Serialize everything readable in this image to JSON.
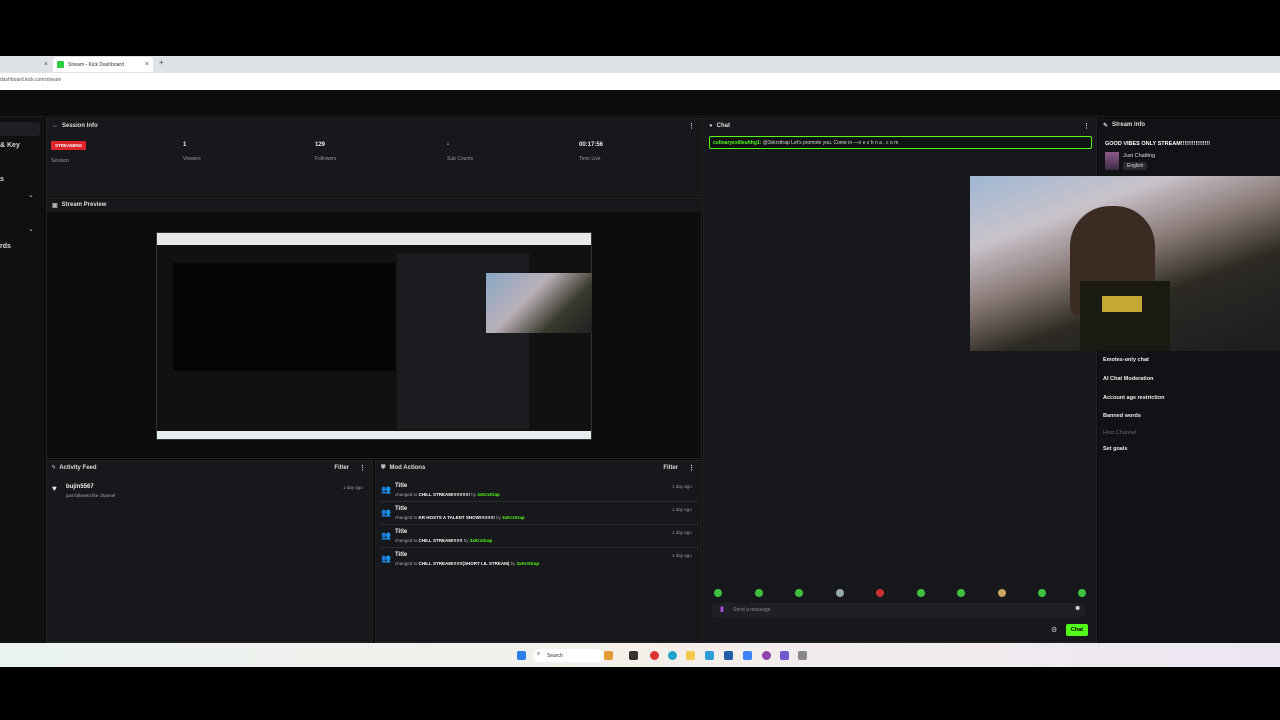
{
  "browser": {
    "tab1_close": "×",
    "tab2_title": "Stream - Kick Dashboard",
    "tab2_close": "×",
    "new_tab": "+",
    "url": "dashboard.kick.com/stream"
  },
  "sidebar": {
    "items": [
      "& Key",
      "s",
      "rds"
    ]
  },
  "session_info": {
    "title": "Session Info",
    "stats": [
      {
        "value": "STREAMING",
        "label": "Session"
      },
      {
        "value": "1",
        "label": "Viewers"
      },
      {
        "value": "129",
        "label": "Followers"
      },
      {
        "value": "-",
        "label": "Sub Counts"
      },
      {
        "value": "00:17:56",
        "label": "Time Live"
      }
    ]
  },
  "stream_preview": {
    "title": "Stream Preview"
  },
  "activity_feed": {
    "title": "Activity Feed",
    "filter": "Filter",
    "items": [
      {
        "user": "bujin5567",
        "text": "just followed the channel",
        "time": "1 day ago"
      }
    ]
  },
  "mod_actions": {
    "title": "Mod Actions",
    "filter": "Filter",
    "items": [
      {
        "title": "Title",
        "prefix": "changed to",
        "value": "CHILL STREAM!!!!!!!!!!!!",
        "by": "by",
        "user": "3xKrxttrap",
        "time": "1 day ago"
      },
      {
        "title": "Title",
        "prefix": "changed to",
        "value": "KR HOSTS A TALENT SHOW!!!!!!!!!!",
        "by": "by",
        "user": "3xKrxttrap",
        "time": "1 day ago"
      },
      {
        "title": "Title",
        "prefix": "changed to",
        "value": "CHILL STREAM!!!!!!!",
        "by": "by",
        "user": "3xKrxttrap",
        "time": "1 day ago"
      },
      {
        "title": "Title",
        "prefix": "changed to",
        "value": "CHILL STREAM!!!!!!!(SHORT LIL STREAM)",
        "by": "by",
        "user": "3xKrxttrap",
        "time": "1 day ago"
      }
    ]
  },
  "chat": {
    "title": "Chat",
    "pinned": {
      "user": "culinaryexilleuhhg1:",
      "text": "@3xkrxttrap Let's promote you. Come in —n e z h n a . c o m"
    },
    "input_placeholder": "Send a message",
    "send_label": "Chat"
  },
  "stream_info": {
    "title": "Stream info",
    "stream_title": "GOOD VIBES ONLY STREAM!!!!!!!!!!!!!!!!",
    "category": "Just Chatting",
    "language": "English"
  },
  "settings": [
    "Emotes-only chat",
    "AI Chat Moderation",
    "Account age restriction",
    "Banned words",
    "Host Channel",
    "Set goals"
  ],
  "taskbar": {
    "search": "Search"
  },
  "colors": {
    "accent": "#53fc18",
    "live": "#e0242b",
    "panel": "#17181b"
  }
}
